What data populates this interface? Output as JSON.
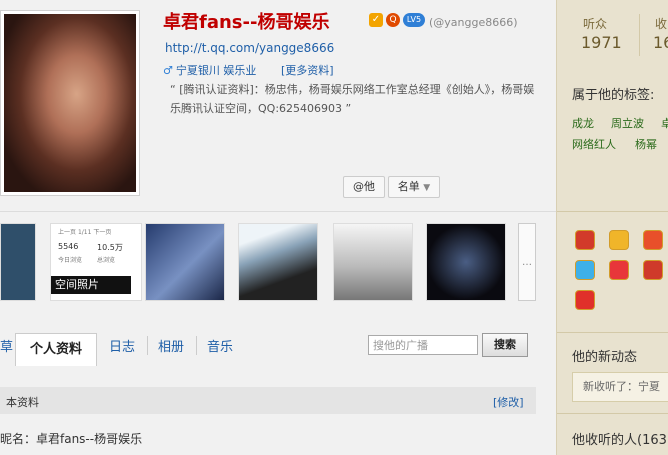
{
  "profile": {
    "name": "卓君fans--杨哥娱乐",
    "badges": [
      "v-badge-icon",
      "qzone-badge-icon",
      "level-badge-icon"
    ],
    "lv_text": "LV5",
    "handle": "(@yangge8666)",
    "url": "http://t.qq.com/yangge8666",
    "location": "宁夏银川 娱乐业",
    "more_link": "[更多资料]",
    "description": "“ [腾讯认证资料]：杨忠伟，杨哥娱乐网络工作室总经理《创始人》，杨哥娱乐腾讯认证空间，QQ:625406903 ”",
    "at_button": "@他",
    "list_button": "名单"
  },
  "photos": {
    "mini_card": {
      "prev": "上一页",
      "page": "1/11",
      "next": "下一页",
      "num1": "5546",
      "num2": "10.5万",
      "label1": "今日浏览",
      "label2": "总浏览"
    },
    "space_label": "空间照片",
    "more": "…"
  },
  "tabs": [
    {
      "label": "草"
    },
    {
      "label": "个人资料"
    },
    {
      "label": "日志"
    },
    {
      "label": "相册"
    },
    {
      "label": "音乐"
    }
  ],
  "search": {
    "placeholder": "搜他的广播",
    "button": "搜索"
  },
  "basic": {
    "title": "本资料",
    "edit": "[修改]",
    "nickname_line": "昵名：卓君fans--杨哥娱乐"
  },
  "sidebar": {
    "listeners_label": "听众",
    "listeners_value": "1971",
    "following_label": "收",
    "following_value": "16",
    "tags_title": "属于他的标签:",
    "tags": [
      "成龙",
      "周立波",
      "卓",
      "网络红人",
      "杨幂"
    ],
    "news_title": "他的新动态",
    "news_text": "新收听了：宁夏"
  },
  "footer_right": {
    "text": "他收听的人(163"
  },
  "colors": {
    "accent_red": "#c00000",
    "link_blue": "#1f5fa8",
    "tag_green": "#2a6a1a",
    "sidebar_bg": "#e8e2cf"
  }
}
